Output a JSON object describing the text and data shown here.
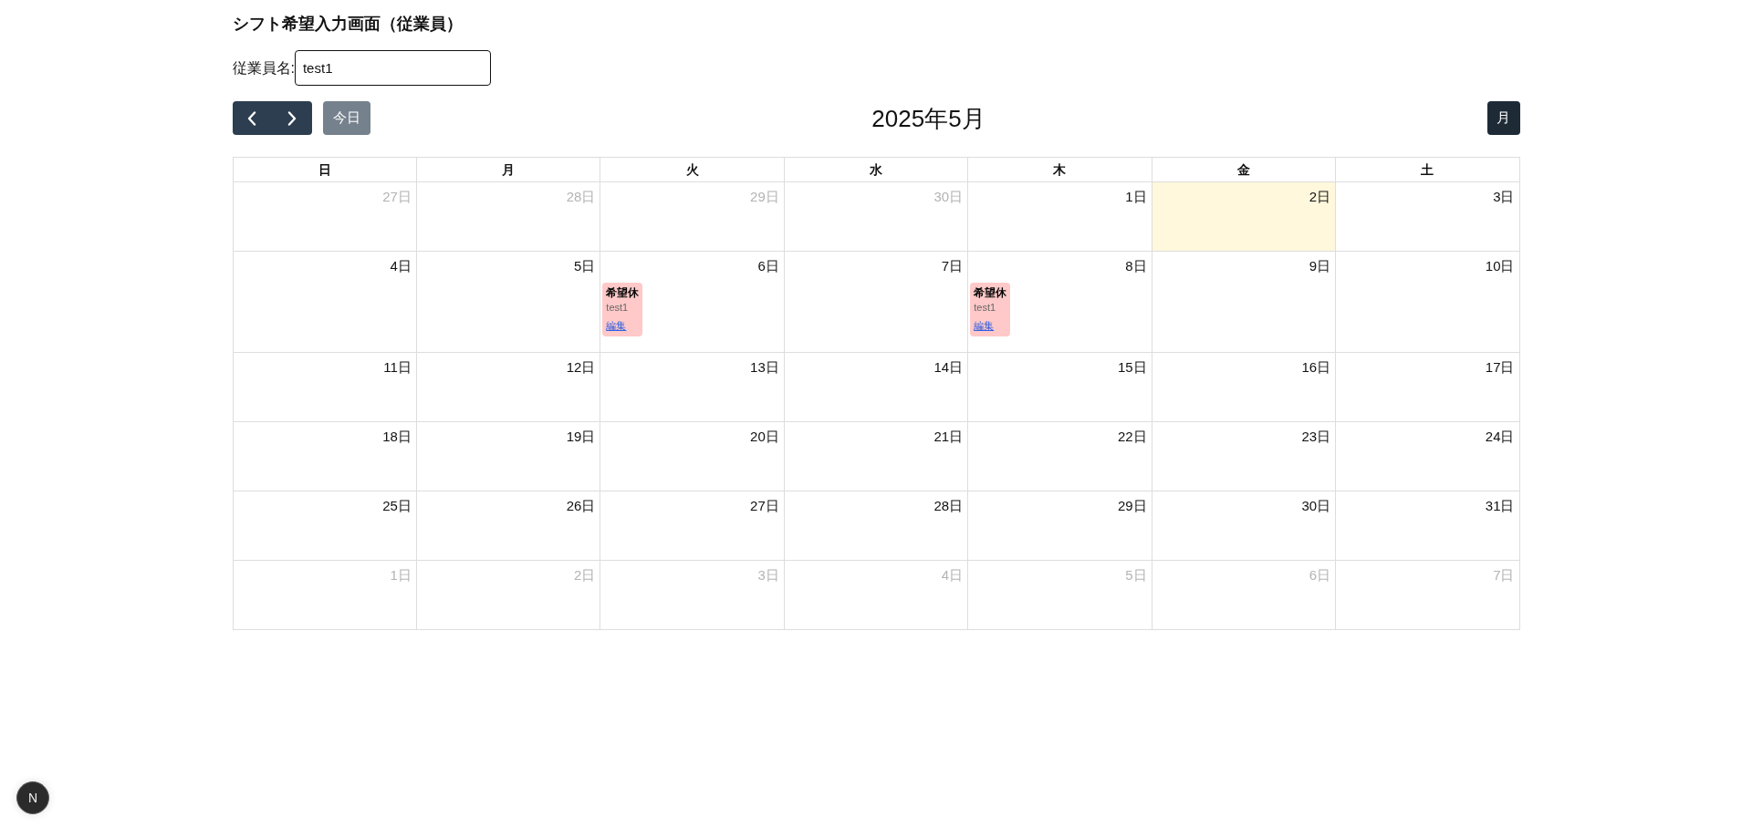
{
  "page": {
    "title": "シフト希望入力画面（従業員）"
  },
  "employee_field": {
    "label": "従業員名:",
    "value": "test1"
  },
  "toolbar": {
    "today_button": {
      "label": "今日",
      "disabled": true
    },
    "title": "2025年5月",
    "view_buttons": [
      {
        "label": "月",
        "selected": true
      }
    ]
  },
  "calendar": {
    "weekdays": [
      "日",
      "月",
      "火",
      "水",
      "木",
      "金",
      "土"
    ],
    "weeks": [
      {
        "days": [
          {
            "label": "27日",
            "other_month": true,
            "today": false
          },
          {
            "label": "28日",
            "other_month": true,
            "today": false
          },
          {
            "label": "29日",
            "other_month": true,
            "today": false
          },
          {
            "label": "30日",
            "other_month": true,
            "today": false
          },
          {
            "label": "1日",
            "other_month": false,
            "today": false
          },
          {
            "label": "2日",
            "other_month": false,
            "today": true
          },
          {
            "label": "3日",
            "other_month": false,
            "today": false
          }
        ]
      },
      {
        "days": [
          {
            "label": "4日",
            "other_month": false,
            "today": false
          },
          {
            "label": "5日",
            "other_month": false,
            "today": false
          },
          {
            "label": "6日",
            "other_month": false,
            "today": false,
            "events": [
              {
                "title": "希望休",
                "name": "test1",
                "link": "編集"
              }
            ]
          },
          {
            "label": "7日",
            "other_month": false,
            "today": false
          },
          {
            "label": "8日",
            "other_month": false,
            "today": false,
            "events": [
              {
                "title": "希望休",
                "name": "test1",
                "link": "編集"
              }
            ]
          },
          {
            "label": "9日",
            "other_month": false,
            "today": false
          },
          {
            "label": "10日",
            "other_month": false,
            "today": false
          }
        ]
      },
      {
        "days": [
          {
            "label": "11日",
            "other_month": false,
            "today": false
          },
          {
            "label": "12日",
            "other_month": false,
            "today": false
          },
          {
            "label": "13日",
            "other_month": false,
            "today": false
          },
          {
            "label": "14日",
            "other_month": false,
            "today": false
          },
          {
            "label": "15日",
            "other_month": false,
            "today": false
          },
          {
            "label": "16日",
            "other_month": false,
            "today": false
          },
          {
            "label": "17日",
            "other_month": false,
            "today": false
          }
        ]
      },
      {
        "days": [
          {
            "label": "18日",
            "other_month": false,
            "today": false
          },
          {
            "label": "19日",
            "other_month": false,
            "today": false
          },
          {
            "label": "20日",
            "other_month": false,
            "today": false
          },
          {
            "label": "21日",
            "other_month": false,
            "today": false
          },
          {
            "label": "22日",
            "other_month": false,
            "today": false
          },
          {
            "label": "23日",
            "other_month": false,
            "today": false
          },
          {
            "label": "24日",
            "other_month": false,
            "today": false
          }
        ]
      },
      {
        "days": [
          {
            "label": "25日",
            "other_month": false,
            "today": false
          },
          {
            "label": "26日",
            "other_month": false,
            "today": false
          },
          {
            "label": "27日",
            "other_month": false,
            "today": false
          },
          {
            "label": "28日",
            "other_month": false,
            "today": false
          },
          {
            "label": "29日",
            "other_month": false,
            "today": false
          },
          {
            "label": "30日",
            "other_month": false,
            "today": false
          },
          {
            "label": "31日",
            "other_month": false,
            "today": false
          }
        ]
      },
      {
        "days": [
          {
            "label": "1日",
            "other_month": true,
            "today": false
          },
          {
            "label": "2日",
            "other_month": true,
            "today": false
          },
          {
            "label": "3日",
            "other_month": true,
            "today": false
          },
          {
            "label": "4日",
            "other_month": true,
            "today": false
          },
          {
            "label": "5日",
            "other_month": true,
            "today": false
          },
          {
            "label": "6日",
            "other_month": true,
            "today": false
          },
          {
            "label": "7日",
            "other_month": true,
            "today": false
          }
        ]
      }
    ]
  },
  "dev_badge": {
    "label": "N"
  }
}
